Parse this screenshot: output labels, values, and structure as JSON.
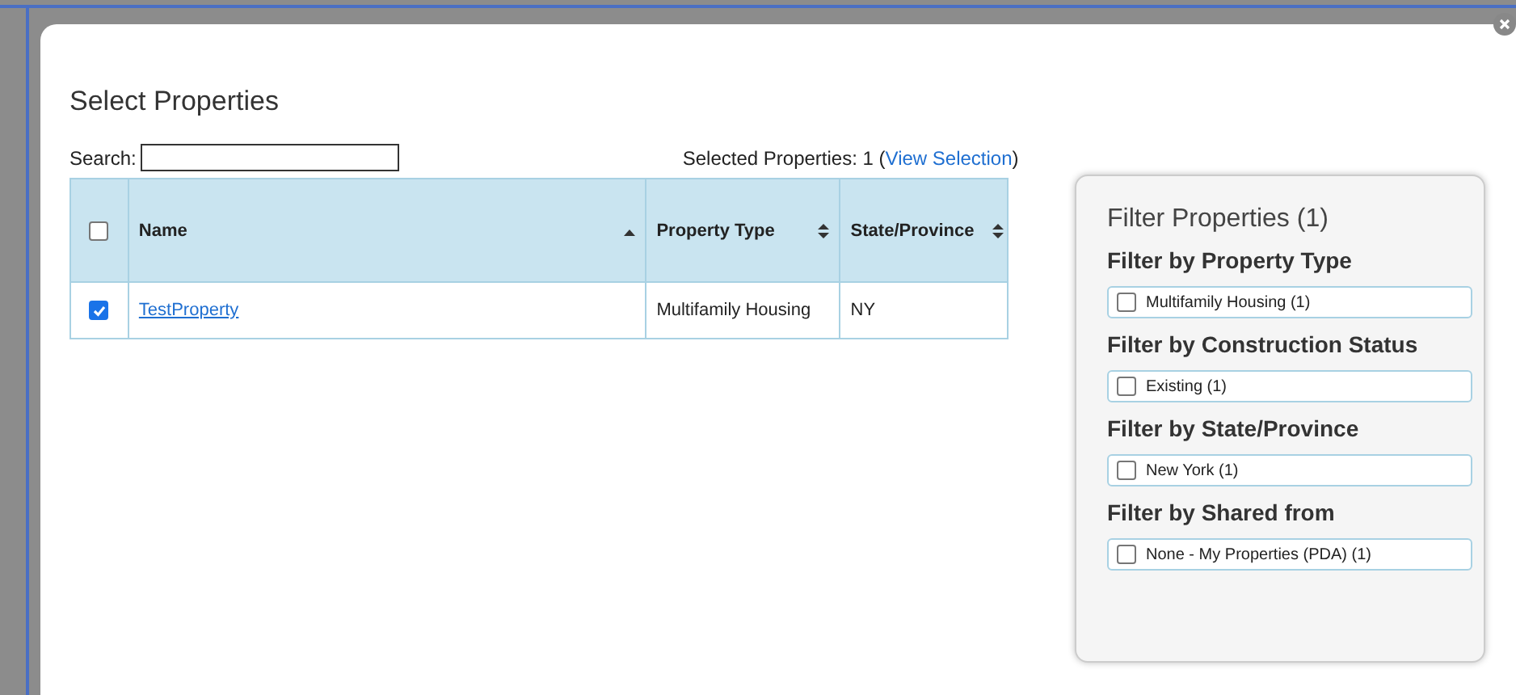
{
  "dialog": {
    "title": "Select Properties",
    "search": {
      "label": "Search:"
    },
    "selection_summary": {
      "label": "Selected Properties: 1",
      "open": "(",
      "link": "View Selection",
      "close": ")"
    },
    "table": {
      "select_all": {
        "checked": false
      },
      "columns": [
        {
          "label": "Name",
          "kind": "sorted"
        },
        {
          "label": "Property Type",
          "kind": "sortable"
        },
        {
          "label": "State/Province",
          "kind": "sortable"
        }
      ],
      "rows": [
        {
          "checked": true,
          "name": "TestProperty",
          "property_type": "Multifamily Housing",
          "state": "NY"
        }
      ]
    },
    "filter_panel": {
      "title": "Filter Properties (1)",
      "groups": [
        {
          "heading": "Filter by Property Type",
          "options": [
            {
              "label": "Multifamily Housing (1)",
              "checked": false
            }
          ]
        },
        {
          "heading": "Filter by Construction Status",
          "options": [
            {
              "label": "Existing (1)",
              "checked": false
            }
          ]
        },
        {
          "heading": "Filter by State/Province",
          "options": [
            {
              "label": "New York (1)",
              "checked": false
            }
          ]
        },
        {
          "heading": "Filter by Shared from",
          "options": [
            {
              "label": "None - My Properties (PDA) (1)",
              "checked": false
            }
          ]
        }
      ]
    }
  }
}
